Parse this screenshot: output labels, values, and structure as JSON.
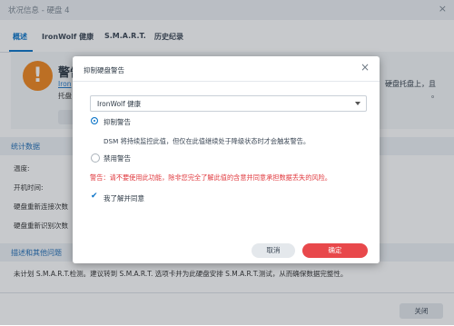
{
  "window": {
    "title": "状况信息 - 硬盘 4",
    "close": "×"
  },
  "tabs": [
    {
      "label": "概述"
    },
    {
      "label": "IronWolf 健康"
    },
    {
      "label": "S.M.A.R.T."
    },
    {
      "label": "历史纪录"
    }
  ],
  "warning_panel": {
    "icon": "!",
    "title": "警告",
    "link": "Iron",
    "line1": "托盘",
    "right1": "硬盘托盘上，且",
    "right2": "。",
    "button": "修"
  },
  "stats": {
    "heading": "统计数据",
    "rows": [
      "温度:",
      "开机时间:",
      "硬盘重新连接次数",
      "硬盘重新识别次数"
    ]
  },
  "description": {
    "heading": "描述和其他问题",
    "text": "未计划 S.M.A.R.T.检测。建议转到 S.M.A.R.T. 选项卡并为此硬盘安排 S.M.A.R.T.测试，从而确保数据完整性。"
  },
  "footer": {
    "close_label": "关闭"
  },
  "dialog": {
    "title": "抑制硬盘警告",
    "close": "×",
    "select_value": "IronWolf 健康",
    "option1": "抑制警告",
    "option1_hint": "DSM 将持续监控此值，但仅在此值继续处于降级状态时才会触发警告。",
    "option2": "禁用警告",
    "warning": "警告：请不要使用此功能，除非您完全了解此值的含意并同意承担数据丢失的风险。",
    "agree": "我了解并同意",
    "check": "✔",
    "cancel": "取消",
    "ok": "确定"
  },
  "colors": {
    "accent": "#0b74c8",
    "danger": "#e8484b",
    "warning_icon": "#f0861d"
  }
}
